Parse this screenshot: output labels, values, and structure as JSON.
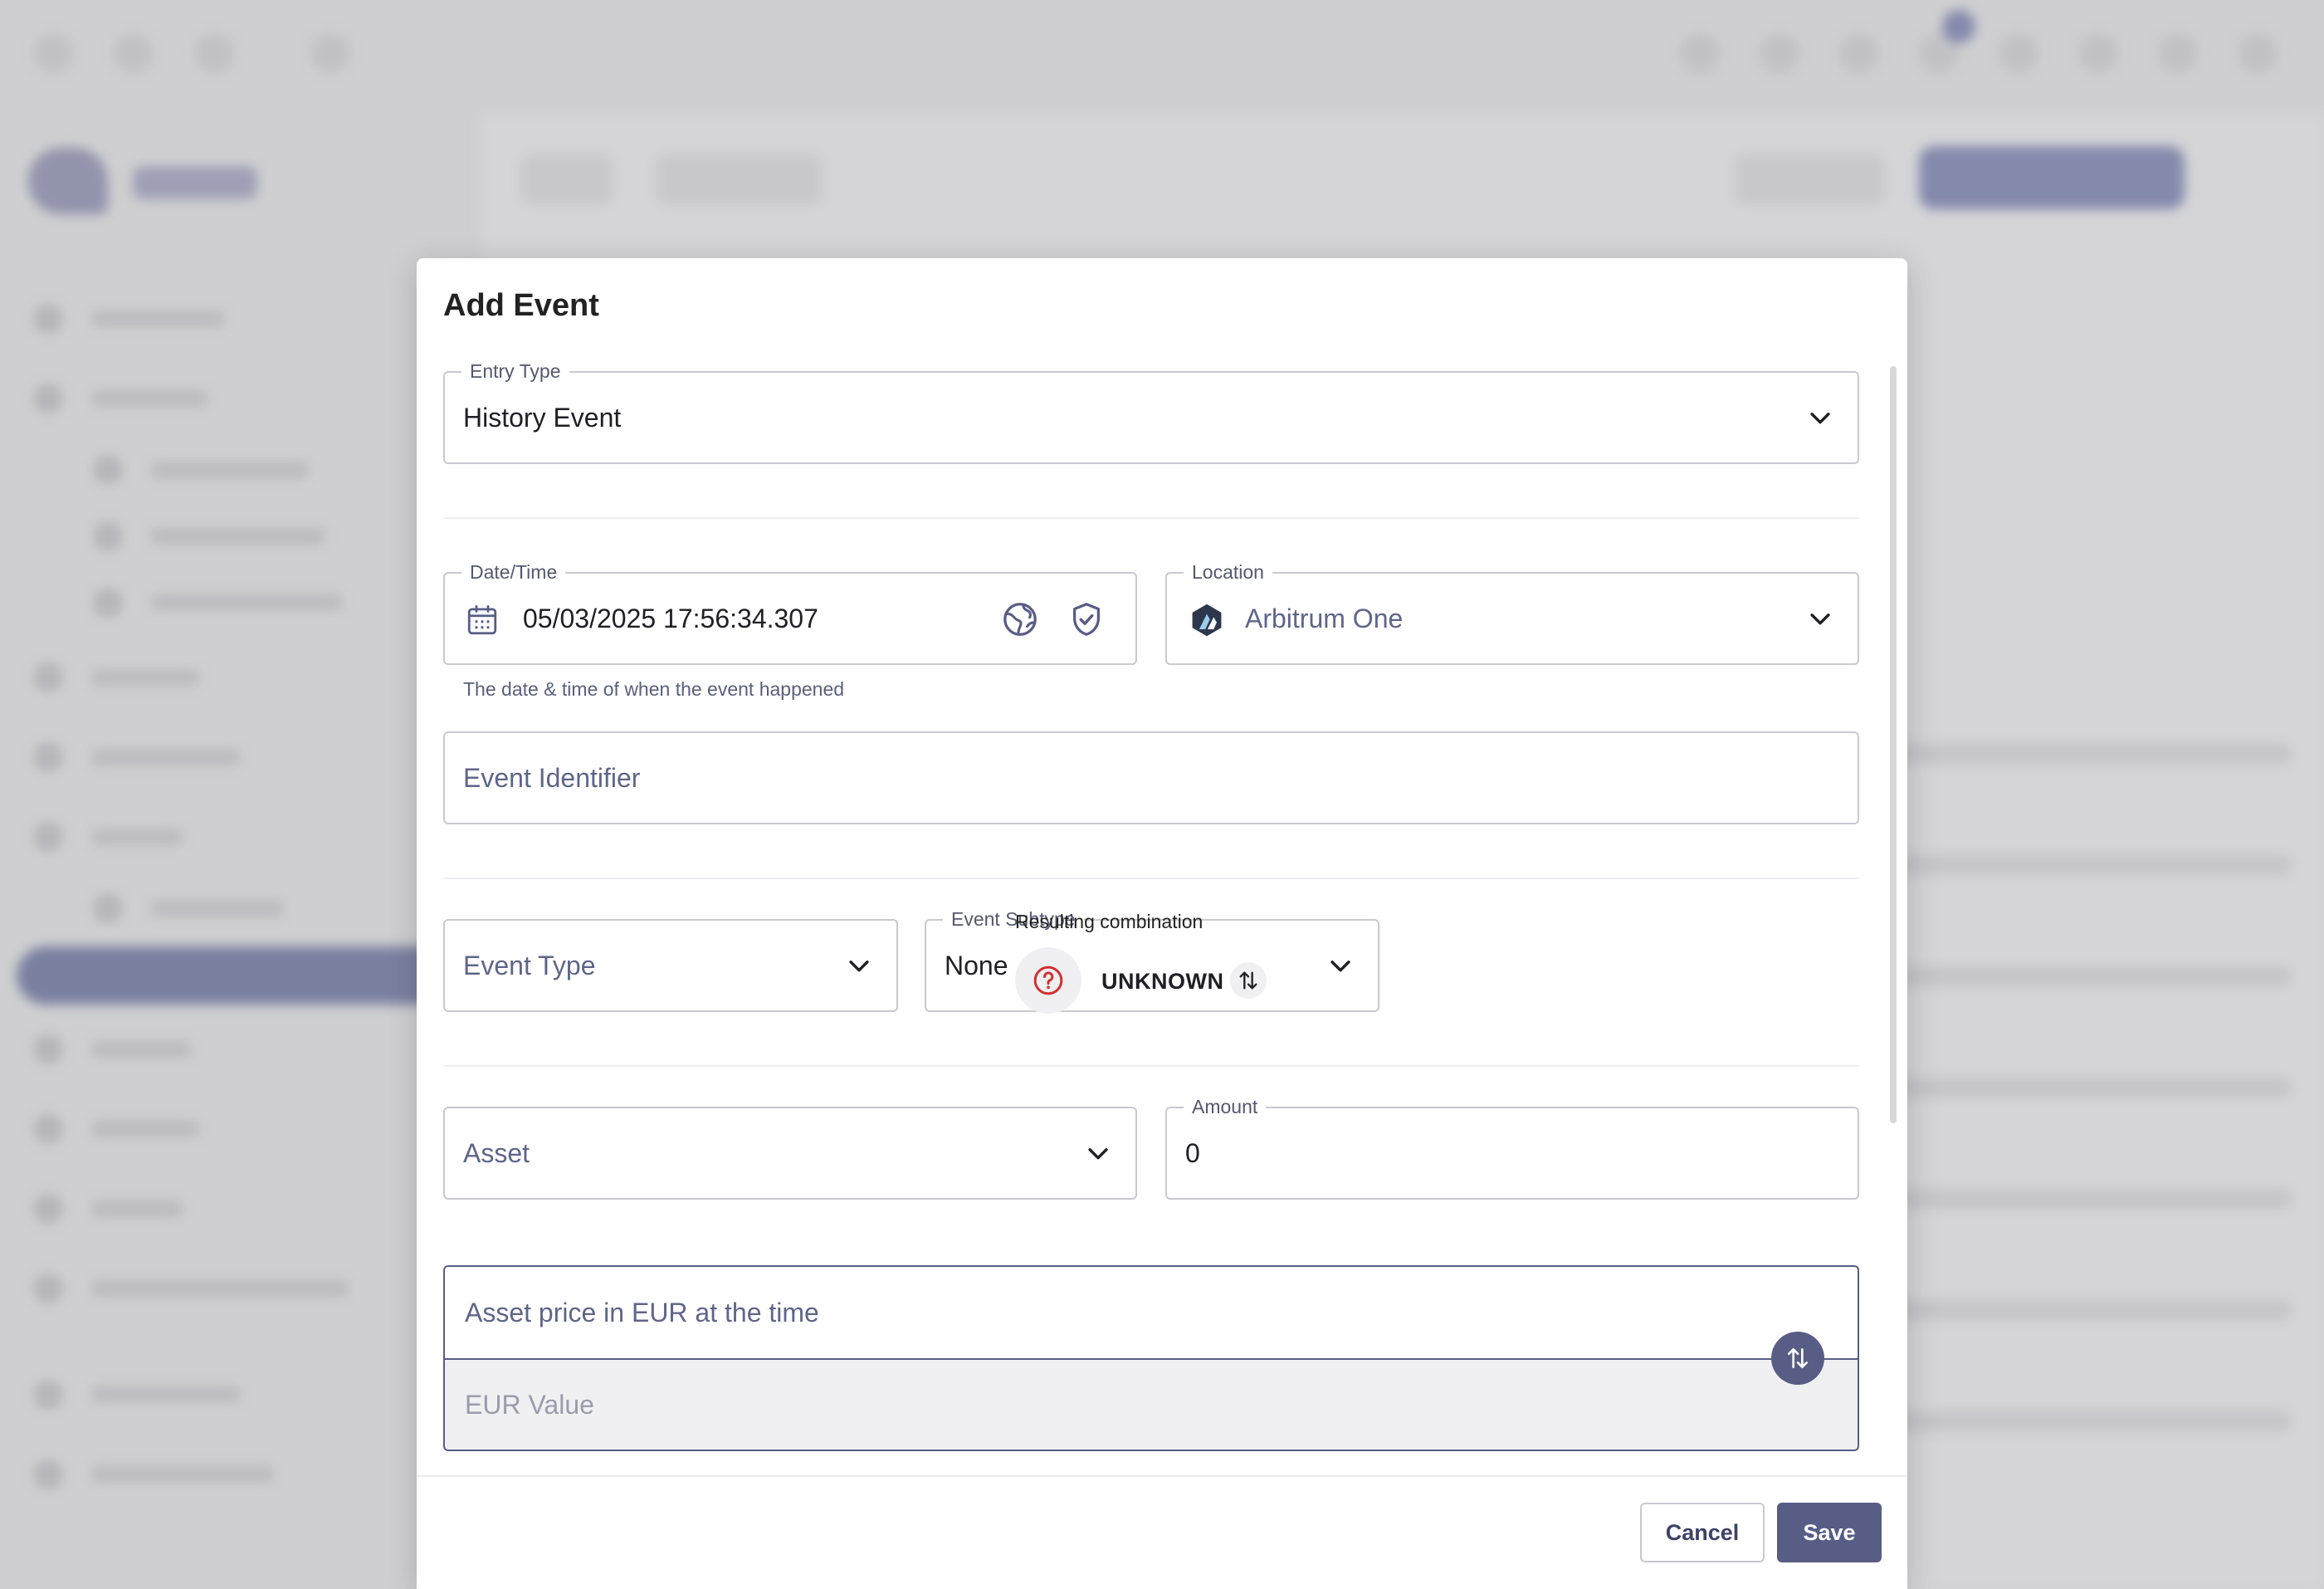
{
  "dialog": {
    "title": "Add Event",
    "entry_type": {
      "label": "Entry Type",
      "value": "History Event"
    },
    "datetime": {
      "label": "Date/Time",
      "value": "05/03/2025 17:56:34.307",
      "hint": "The date & time of when the event happened"
    },
    "location": {
      "label": "Location",
      "value": "Arbitrum One"
    },
    "event_identifier": {
      "placeholder": "Event Identifier"
    },
    "event_type": {
      "placeholder": "Event Type"
    },
    "event_subtype": {
      "label": "Event Subtype",
      "value": "None"
    },
    "resulting": {
      "label": "Resulting combination",
      "value": "UNKNOWN"
    },
    "asset": {
      "placeholder": "Asset"
    },
    "amount": {
      "label": "Amount",
      "value": "0"
    },
    "price": {
      "placeholder": "Asset price in EUR at the time",
      "value_placeholder": "EUR Value"
    },
    "buttons": {
      "cancel": "Cancel",
      "save": "Save"
    }
  },
  "colors": {
    "accent": "#585d85",
    "unknown_icon": "#d32f2f"
  }
}
